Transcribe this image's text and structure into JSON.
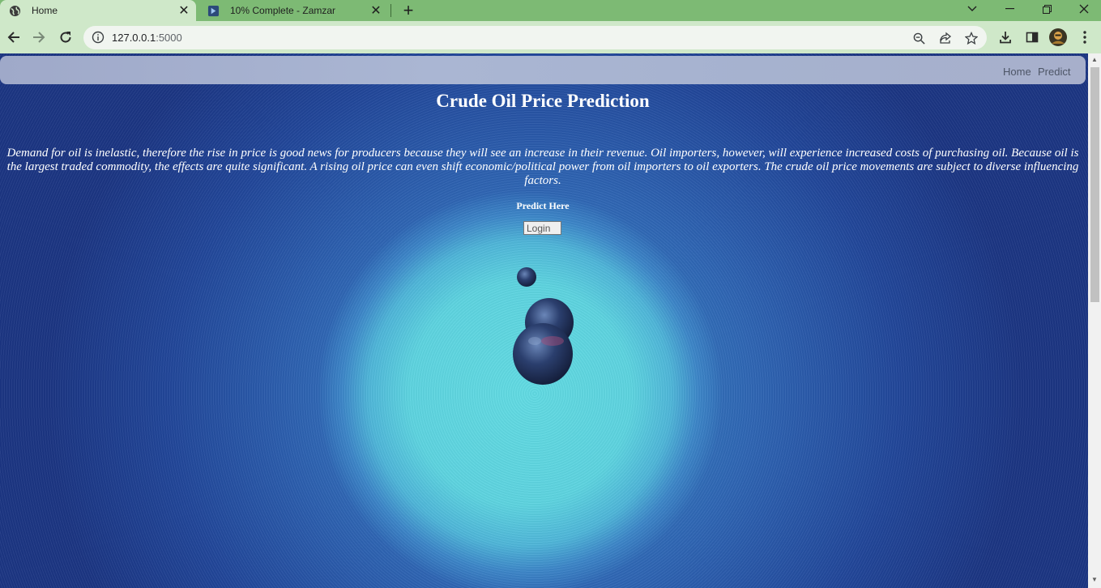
{
  "browser": {
    "tabs": [
      {
        "title": "Home",
        "icon": "globe-icon",
        "active": true
      },
      {
        "title": "10% Complete - Zamzar",
        "icon": "zamzar-icon",
        "active": false
      }
    ],
    "url_host": "127.0.0.1",
    "url_port": ":5000"
  },
  "page": {
    "nav": {
      "home": "Home",
      "predict": "Predict"
    },
    "title": "Crude Oil Price Prediction",
    "description": "Demand for oil is inelastic, therefore the rise in price is good news for producers because they will see an increase in their revenue. Oil importers, however, will experience increased costs of purchasing oil. Because oil is the largest traded commodity, the effects are quite significant. A rising oil price can even shift economic/political power from oil importers to oil exporters. The crude oil price movements are subject to diverse influencing factors.",
    "predict_here": "Predict Here",
    "login_button": "Login"
  },
  "colors": {
    "tabstrip": "#7dba74",
    "toolbar": "#cfe8c9",
    "page_text": "#ffffff"
  }
}
